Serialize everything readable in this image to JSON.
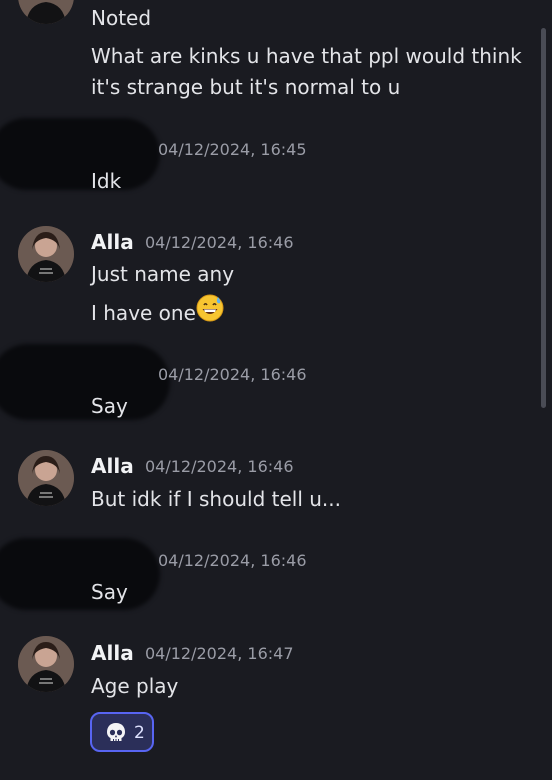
{
  "messages": {
    "m1": {
      "text": "Noted"
    },
    "m2": {
      "line1": "What are kinks u have that ppl would think",
      "line2": "it's strange but it's normal to u"
    },
    "m3": {
      "timestamp": "04/12/2024, 16:45",
      "text": "Idk"
    },
    "m4": {
      "author": "Alla",
      "timestamp": "04/12/2024, 16:46",
      "line1": "Just name any",
      "line2": "I have one",
      "emoji": "grinning-sweat-emoji"
    },
    "m5": {
      "timestamp": "04/12/2024, 16:46",
      "text": "Say"
    },
    "m6": {
      "author": "Alla",
      "timestamp": "04/12/2024, 16:46",
      "text": "But idk if I should tell u..."
    },
    "m7": {
      "timestamp": "04/12/2024, 16:46",
      "text": "Say"
    },
    "m8": {
      "author": "Alla",
      "timestamp": "04/12/2024, 16:47",
      "text": "Age play",
      "reaction": {
        "emoji": "skull-emoji",
        "count": "2"
      }
    }
  },
  "colors": {
    "background": "#1a1b21",
    "reaction_border": "#5865f2",
    "reaction_bg": "#2b2f59"
  }
}
